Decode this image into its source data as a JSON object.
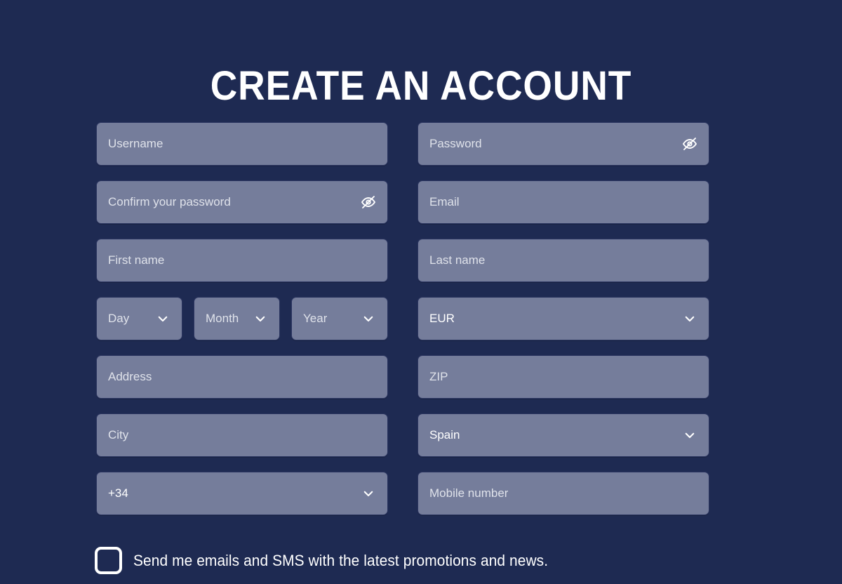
{
  "page": {
    "title": "CREATE AN ACCOUNT",
    "background_color": "#1e2a52",
    "field_color": "#757d9b",
    "text_color": "#ffffff",
    "placeholder_color": "#dfe2ea"
  },
  "form": {
    "rows": [
      {
        "left": [
          {
            "name": "username",
            "kind": "text",
            "placeholder": "Username",
            "value": "",
            "icon": null
          }
        ],
        "right": [
          {
            "name": "password",
            "kind": "password",
            "placeholder": "Password",
            "value": "",
            "icon": "eye-off-icon"
          }
        ]
      },
      {
        "left": [
          {
            "name": "confirm-password",
            "kind": "password",
            "placeholder": "Confirm your password",
            "value": "",
            "icon": "eye-off-icon"
          }
        ],
        "right": [
          {
            "name": "email",
            "kind": "text",
            "placeholder": "Email",
            "value": "",
            "icon": null
          }
        ]
      },
      {
        "left": [
          {
            "name": "first-name",
            "kind": "text",
            "placeholder": "First name",
            "value": "",
            "icon": null
          }
        ],
        "right": [
          {
            "name": "last-name",
            "kind": "text",
            "placeholder": "Last name",
            "value": "",
            "icon": null
          }
        ]
      },
      {
        "left": [
          {
            "name": "day",
            "kind": "select",
            "placeholder": "Day",
            "value": "",
            "icon": "chevron-down-icon"
          },
          {
            "name": "month",
            "kind": "select",
            "placeholder": "Month",
            "value": "",
            "icon": "chevron-down-icon"
          },
          {
            "name": "year",
            "kind": "select",
            "placeholder": "Year",
            "value": "",
            "icon": "chevron-down-icon"
          }
        ],
        "right": [
          {
            "name": "currency",
            "kind": "select",
            "placeholder": "",
            "value": "EUR",
            "icon": "chevron-down-icon"
          }
        ]
      },
      {
        "left": [
          {
            "name": "address",
            "kind": "text",
            "placeholder": "Address",
            "value": "",
            "icon": null
          }
        ],
        "right": [
          {
            "name": "zip",
            "kind": "text",
            "placeholder": "ZIP",
            "value": "",
            "icon": null
          }
        ]
      },
      {
        "left": [
          {
            "name": "city",
            "kind": "text",
            "placeholder": "City",
            "value": "",
            "icon": null
          }
        ],
        "right": [
          {
            "name": "country",
            "kind": "select",
            "placeholder": "",
            "value": "Spain",
            "icon": "chevron-down-icon"
          }
        ]
      },
      {
        "left": [
          {
            "name": "dial-code",
            "kind": "select",
            "placeholder": "",
            "value": "+34",
            "icon": "chevron-down-icon"
          }
        ],
        "right": [
          {
            "name": "mobile-number",
            "kind": "text",
            "placeholder": "Mobile number",
            "value": "",
            "icon": null
          }
        ]
      }
    ]
  },
  "consent": {
    "checked": false,
    "label": "Send me emails and SMS with the latest promotions and news."
  },
  "fields": {
    "username": {
      "placeholder": "Username"
    },
    "password": {
      "placeholder": "Password"
    },
    "confirm_password": {
      "placeholder": "Confirm your password"
    },
    "email": {
      "placeholder": "Email"
    },
    "first_name": {
      "placeholder": "First name"
    },
    "last_name": {
      "placeholder": "Last name"
    },
    "day": {
      "placeholder": "Day"
    },
    "month": {
      "placeholder": "Month"
    },
    "year": {
      "placeholder": "Year"
    },
    "currency": {
      "value": "EUR"
    },
    "address": {
      "placeholder": "Address"
    },
    "zip": {
      "placeholder": "ZIP"
    },
    "city": {
      "placeholder": "City"
    },
    "country": {
      "value": "Spain"
    },
    "dial_code": {
      "value": "+34"
    },
    "mobile_number": {
      "placeholder": "Mobile number"
    }
  }
}
